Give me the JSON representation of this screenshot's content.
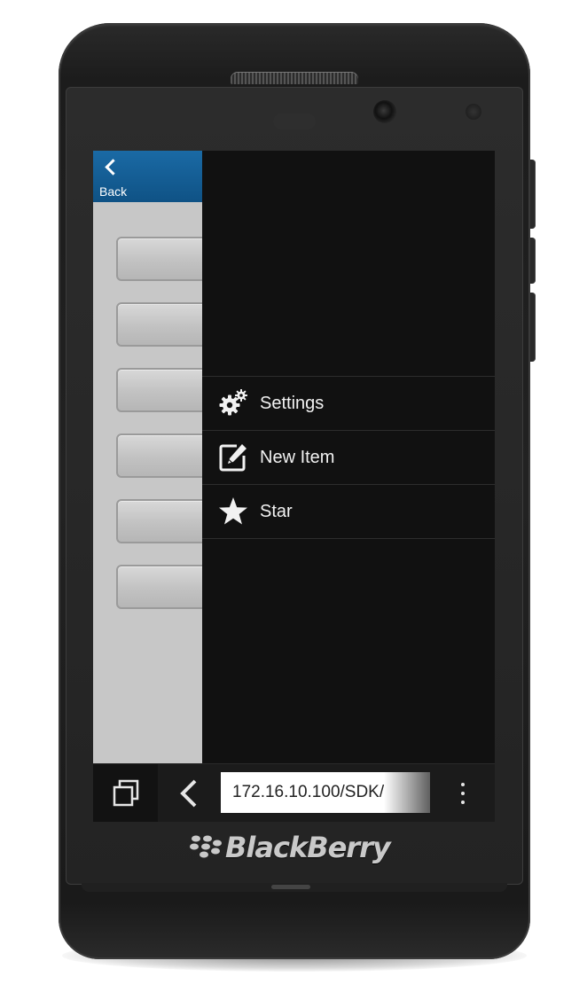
{
  "device": {
    "brand_name": "BlackBerry"
  },
  "header": {
    "back_label": "Back"
  },
  "menu": {
    "items": [
      {
        "label": "Settings",
        "icon": "gears-icon"
      },
      {
        "label": "New Item",
        "icon": "new-item-icon"
      },
      {
        "label": "Star",
        "icon": "star-icon"
      }
    ]
  },
  "browser": {
    "url": "172.16.10.100/SDK/"
  },
  "colors": {
    "header_blue": "#0f5285",
    "menu_background": "#111111",
    "list_background": "#c7c7c7"
  }
}
